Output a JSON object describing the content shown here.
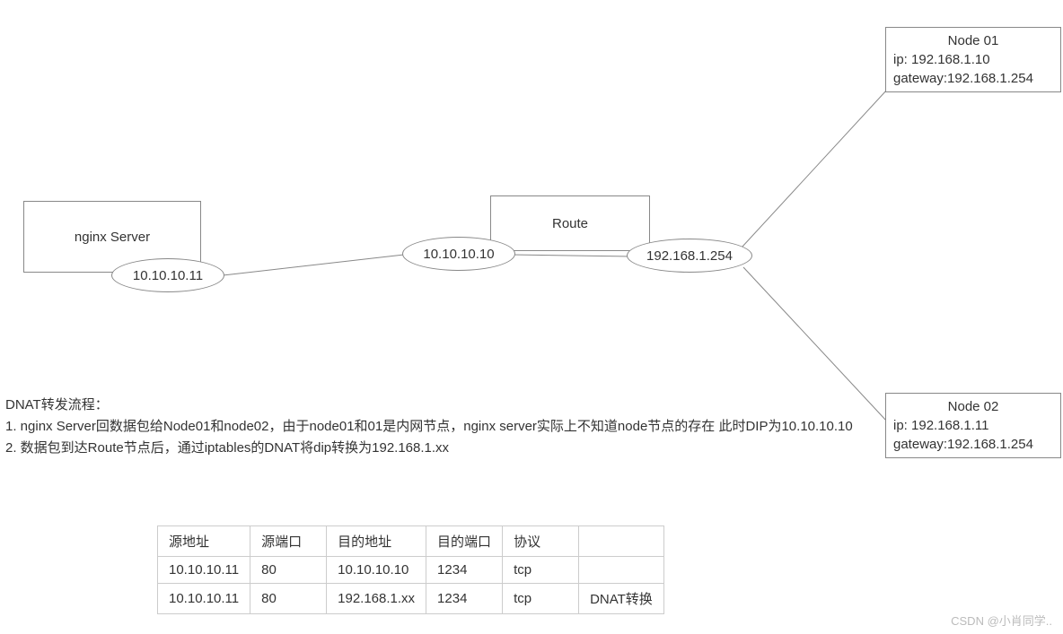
{
  "diagram": {
    "nginx_box": "nginx  Server",
    "route_box": "Route",
    "ellipses": {
      "nginx_ip": "10.10.10.11",
      "route_left": "10.10.10.10",
      "route_right": "192.168.1.254"
    },
    "nodes": {
      "node01": {
        "title": "Node 01",
        "ip_label": "ip:   192.168.1.10",
        "gw_label": "gateway:192.168.1.254"
      },
      "node02": {
        "title": "Node 02",
        "ip_label": "ip:   192.168.1.11",
        "gw_label": "gateway:192.168.1.254"
      }
    }
  },
  "description": {
    "heading": "DNAT转发流程：",
    "line1": "1.   nginx Server回数据包给Node01和node02，由于node01和01是内网节点，nginx server实际上不知道node节点的存在 此时DIP为10.10.10.10",
    "line2": "2.   数据包到达Route节点后，通过iptables的DNAT将dip转换为192.168.1.xx"
  },
  "table": {
    "headers": {
      "src_addr": "源地址",
      "src_port": "源端口",
      "dst_addr": "目的地址",
      "dst_port": "目的端口",
      "proto": "协议",
      "note": ""
    },
    "rows": [
      {
        "src_addr": "10.10.10.11",
        "src_port": "80",
        "dst_addr": "10.10.10.10",
        "dst_port": "1234",
        "proto": "tcp",
        "note": ""
      },
      {
        "src_addr": "10.10.10.11",
        "src_port": "80",
        "dst_addr": "192.168.1.xx",
        "dst_port": "1234",
        "proto": "tcp",
        "note": "DNAT转换"
      }
    ]
  },
  "watermark": "CSDN @小肖同学.."
}
